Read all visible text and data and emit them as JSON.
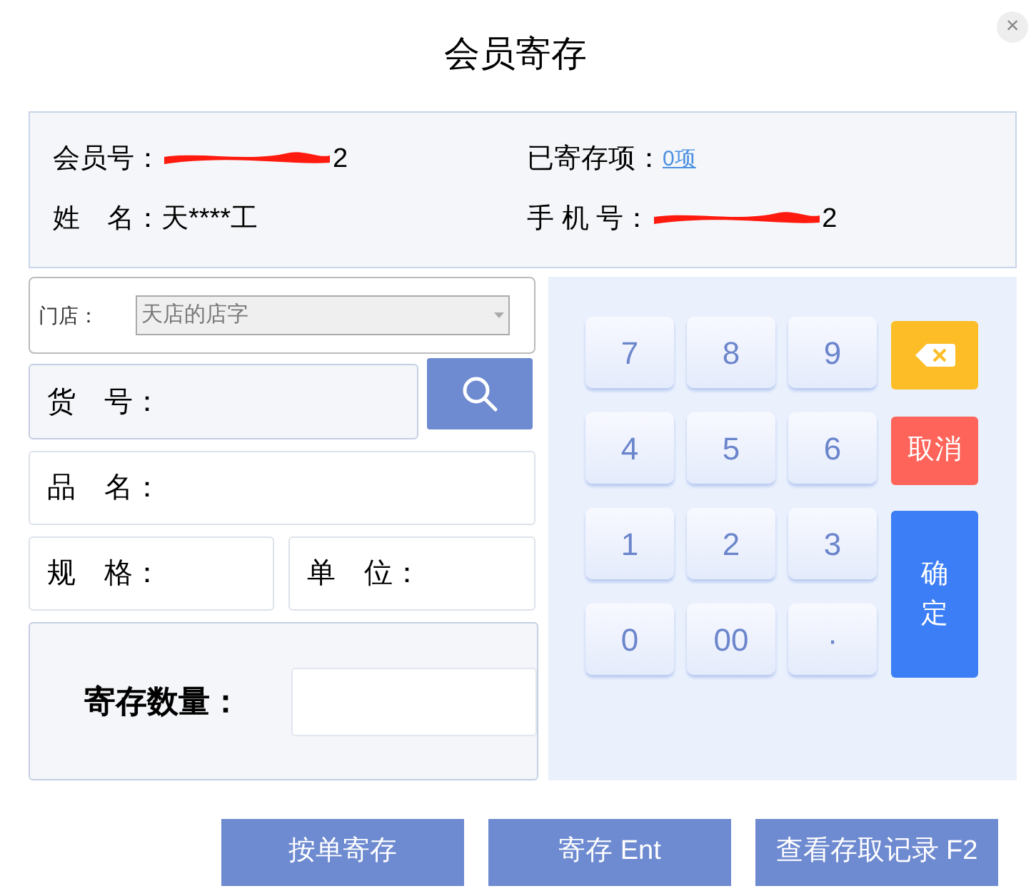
{
  "window": {
    "title": "会员寄存",
    "close": "×"
  },
  "member": {
    "fields": [
      {
        "label": "会员号：",
        "value": "2",
        "redacted": true
      },
      {
        "label": "已寄存项：",
        "link": "0项"
      },
      {
        "label": "姓　名：",
        "value": "天****工",
        "redacted": false
      },
      {
        "label": "手 机 号：",
        "value": "2",
        "redacted": true
      }
    ]
  },
  "store": {
    "label": "门店：",
    "value": "天店的店字"
  },
  "form": {
    "item_no": "货　号：",
    "name": "品　名：",
    "spec": "规　格：",
    "unit": "单　位：",
    "quantity": "寄存数量："
  },
  "keypad": {
    "keys": [
      "7",
      "8",
      "9",
      "4",
      "5",
      "6",
      "1",
      "2",
      "3",
      "0",
      "00",
      "·"
    ],
    "cancel": "取消",
    "confirm": "确定"
  },
  "buttons": [
    "按单寄存",
    "寄存 Ent",
    "查看存取记录 F2"
  ]
}
